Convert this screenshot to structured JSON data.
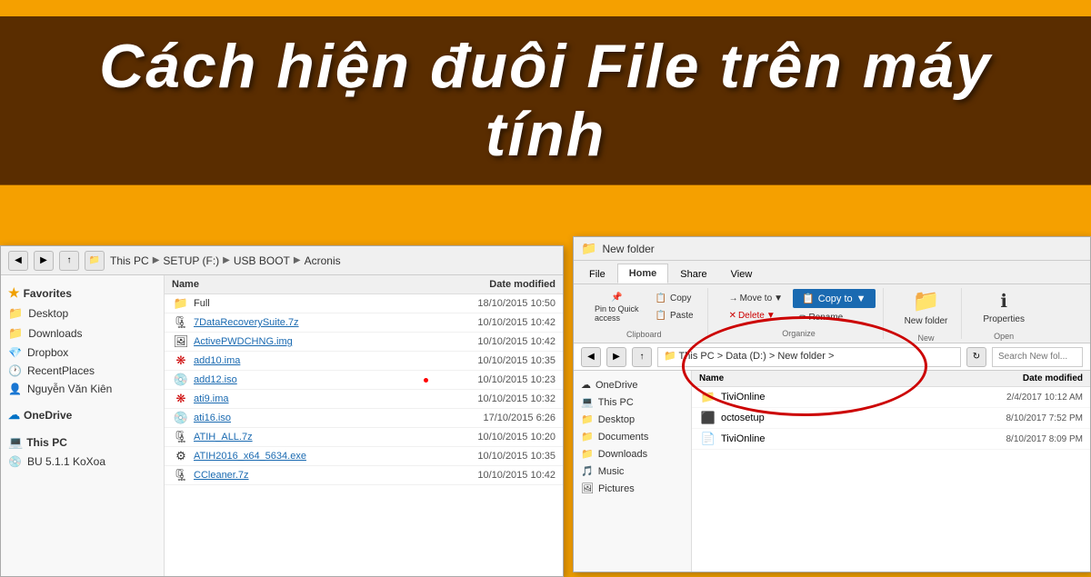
{
  "banner": {
    "text": "Cách hiện đuôi File trên máy tính"
  },
  "left_explorer": {
    "title": "Acronis",
    "path": "This PC > SETUP (F:) > USB BOOT > Acronis",
    "breadcrumbs": [
      "This PC",
      "SETUP (F:)",
      "USB BOOT",
      "Acronis"
    ],
    "sidebar": {
      "favorites_label": "Favorites",
      "items": [
        {
          "label": "Desktop",
          "type": "folder"
        },
        {
          "label": "Downloads",
          "type": "folder"
        },
        {
          "label": "Dropbox",
          "type": "dropbox"
        },
        {
          "label": "RecentPlaces",
          "type": "recent"
        },
        {
          "label": "Nguyễn Văn Kiên",
          "type": "user"
        }
      ],
      "onedrive_label": "OneDrive",
      "thispc_label": "This PC",
      "thispc_items": [
        {
          "label": "BU 5.1.1 KoXoa"
        }
      ]
    },
    "columns": {
      "name": "Name",
      "date_modified": "Date modified"
    },
    "files": [
      {
        "name": "Full",
        "type": "folder",
        "date": ""
      },
      {
        "name": "7DataRecoverySuite.7z",
        "type": "7z",
        "date": "10/10/2015 10:42"
      },
      {
        "name": "ActivePWDCHNG.img",
        "type": "img",
        "date": "10/10/2015 10:42"
      },
      {
        "name": "add10.ima",
        "type": "ima",
        "date": "10/10/2015 10:35"
      },
      {
        "name": "add12.iso",
        "type": "iso",
        "date": "10/10/2015 10:23"
      },
      {
        "name": "ati9.ima",
        "type": "ima",
        "date": "10/10/2015 10:32"
      },
      {
        "name": "ati16.iso",
        "type": "iso",
        "date": "17/10/2015 6:26"
      },
      {
        "name": "ATIH_ALL.7z",
        "type": "7z",
        "date": "10/10/2015 10:20"
      },
      {
        "name": "ATIH2016_x64_5634.exe",
        "type": "exe",
        "date": "10/10/2015 10:35"
      },
      {
        "name": "CCleaner.7z",
        "type": "7z",
        "date": "10/10/2015 10:42"
      }
    ]
  },
  "right_explorer": {
    "title": "New folder",
    "window_title": "New folder",
    "ribbon": {
      "tabs": [
        "File",
        "Home",
        "Share",
        "View"
      ],
      "active_tab": "Home",
      "groups": {
        "clipboard": {
          "label": "Clipboard",
          "pin_label": "Pin to Quick access",
          "copy_label": "Copy",
          "paste_label": "Paste"
        },
        "organize": {
          "label": "Organize",
          "move_to_label": "Move to",
          "copy_to_label": "Copy to",
          "delete_label": "Delete",
          "rename_label": "Rename"
        },
        "new": {
          "label": "New",
          "new_folder_label": "New folder"
        },
        "open": {
          "label": "Open",
          "properties_label": "Properties"
        }
      }
    },
    "path": "This PC > Data (D:) > New folder",
    "breadcrumbs": [
      "This PC",
      "Data (D:)",
      "New folder"
    ],
    "search_placeholder": "Search New fol...",
    "sidebar": {
      "items": [
        {
          "label": "OneDrive",
          "type": "cloud"
        },
        {
          "label": "This PC",
          "type": "pc"
        },
        {
          "label": "Desktop",
          "type": "folder"
        },
        {
          "label": "Documents",
          "type": "folder"
        },
        {
          "label": "Downloads",
          "type": "folder"
        },
        {
          "label": "Music",
          "type": "folder"
        },
        {
          "label": "Pictures",
          "type": "folder"
        }
      ]
    },
    "columns": {
      "name": "Name",
      "date_modified": "Date modified"
    },
    "files": [
      {
        "name": "TiviOnline",
        "type": "folder",
        "date": "2/4/2017 10:12 AM"
      },
      {
        "name": "octosetup",
        "type": "exe",
        "date": "8/10/2017 7:52 PM"
      },
      {
        "name": "TiviOnline",
        "type": "file",
        "date": "8/10/2017 8:09 PM"
      }
    ],
    "highlighted_files": [
      "TiviOnline",
      "octosetup",
      "TiviOnline"
    ]
  }
}
